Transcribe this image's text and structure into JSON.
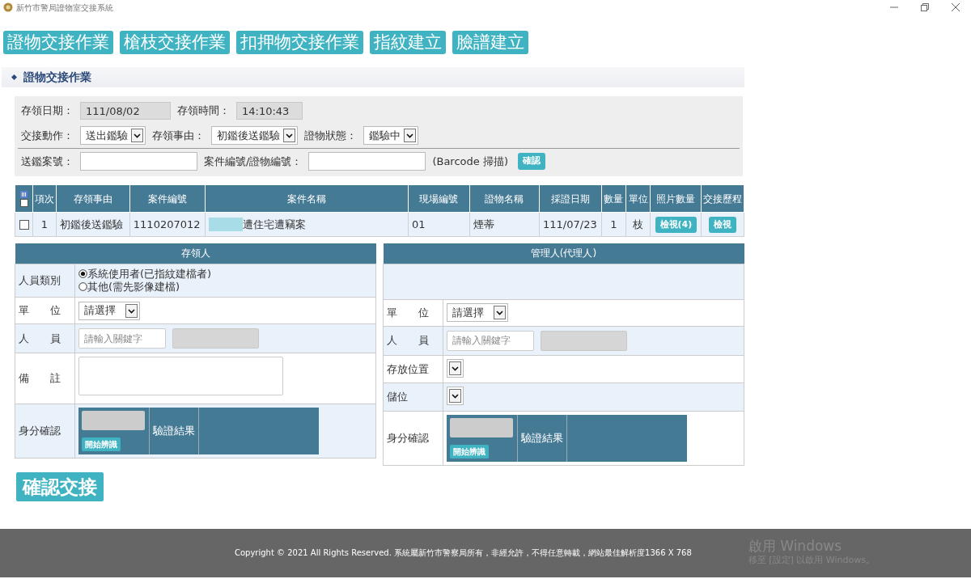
{
  "window": {
    "title": "新竹市警局證物室交接系統"
  },
  "nav_buttons": [
    "證物交接作業",
    "槍枝交接作業",
    "扣押物交接作業",
    "指紋建立",
    "臉譜建立"
  ],
  "section_title": "證物交接作業",
  "form_rows": [
    [
      {
        "kind": "label",
        "text": "存領日期："
      },
      {
        "kind": "readonly",
        "value": "111/08/02"
      },
      {
        "kind": "label",
        "text": "存領時間："
      },
      {
        "kind": "readonly",
        "value": "14:10:43"
      }
    ],
    [
      {
        "kind": "label",
        "text": "交接動作："
      },
      {
        "kind": "select",
        "value": "送出鑑驗"
      },
      {
        "kind": "label",
        "text": "存領事由："
      },
      {
        "kind": "select",
        "value": "初鑑後送鑑驗"
      },
      {
        "kind": "label",
        "text": "證物狀態："
      },
      {
        "kind": "select",
        "value": "鑑驗中"
      }
    ],
    [
      {
        "kind": "label",
        "text": "送鑑案號："
      },
      {
        "kind": "input"
      },
      {
        "kind": "label",
        "text": "案件編號/證物編號："
      },
      {
        "kind": "input"
      },
      {
        "kind": "label",
        "text": "(Barcode 掃描)"
      },
      {
        "kind": "button",
        "text": "確認"
      }
    ]
  ],
  "table": {
    "select_all": {
      "checked": false
    },
    "columns": [
      "項次",
      "存領事由",
      "案件編號",
      "案件名稱",
      "現場編號",
      "證物名稱",
      "採證日期",
      "數量",
      "單位",
      "照片數量",
      "交接歷程"
    ],
    "rows": [
      {
        "checked": false,
        "cells": [
          {
            "kind": "text",
            "text": "1"
          },
          {
            "kind": "text",
            "text": "初鑑後送鑑驗"
          },
          {
            "kind": "text",
            "text": "1110207012"
          },
          {
            "kind": "redacted",
            "text": "遭住宅遭竊案"
          },
          {
            "kind": "text",
            "text": "01"
          },
          {
            "kind": "text",
            "text": "煙蒂"
          },
          {
            "kind": "text",
            "text": "111/07/23"
          },
          {
            "kind": "text",
            "text": "1"
          },
          {
            "kind": "text",
            "text": "枝"
          },
          {
            "kind": "button",
            "text": "檢視(4)"
          },
          {
            "kind": "button",
            "text": "檢視"
          }
        ]
      }
    ]
  },
  "panels": [
    {
      "title": "存領人",
      "rows": [
        {
          "kind": "radio",
          "label": "人員類別",
          "options": [
            {
              "label": "系統使用者(已指紋建檔者)",
              "selected": true
            },
            {
              "label": "其他(需先影像建檔)",
              "selected": false
            }
          ]
        },
        {
          "kind": "select",
          "label": "單　　位",
          "value": "請選擇"
        },
        {
          "kind": "keyword",
          "label": "人　　員",
          "placeholder": "請輸入關鍵字"
        },
        {
          "kind": "textarea",
          "label": "備　　註"
        },
        {
          "kind": "identity",
          "label": "身分確認",
          "button": "開始辨識",
          "result": "驗證結果"
        }
      ]
    },
    {
      "title": "管理人(代理人)",
      "rows": [
        {
          "kind": "blank"
        },
        {
          "kind": "select",
          "label": "單　　位",
          "value": "請選擇"
        },
        {
          "kind": "keyword",
          "label": "人　　員",
          "placeholder": "請輸入關鍵字"
        },
        {
          "kind": "select",
          "label": "存放位置"
        },
        {
          "kind": "select",
          "label": "儲位"
        },
        {
          "kind": "identity",
          "label": "身分確認",
          "button": "開始辨識",
          "result": "驗證結果"
        }
      ]
    }
  ],
  "confirm_button": "確認交接",
  "footer": {
    "copyright": "Copyright © 2021 All Rights Reserved. 系統屬新竹市警察局所有，非經允許，不得任意轉載，網站最佳解析度1366 X 768",
    "activation_title": "啟用 Windows",
    "activation_hint": "移至 [設定] 以啟用 Windows。"
  }
}
